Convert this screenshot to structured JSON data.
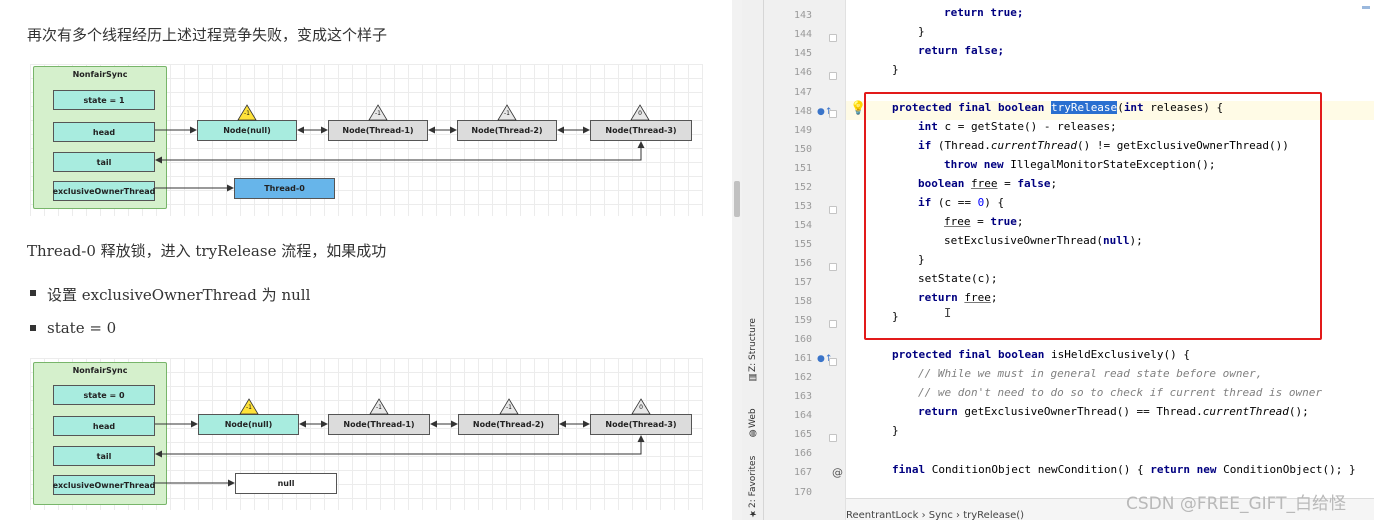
{
  "article": {
    "para1": "再次有多个线程经历上述过程竞争失败，变成这个样子",
    "para2": "Thread-0 释放锁，进入 tryRelease 流程，如果成功",
    "bullets": [
      "设置 exclusiveOwnerThread 为 null",
      "state = 0"
    ]
  },
  "diagram1": {
    "sync_title": "NonfairSync",
    "state": "state = 1",
    "head": "head",
    "tail": "tail",
    "owner": "exclusiveOwnerThread",
    "owner_value": "Thread-0",
    "nodes": [
      "Node(null)",
      "Node(Thread-1)",
      "Node(Thread-2)",
      "Node(Thread-3)"
    ],
    "wait_status": [
      "-1",
      "-1",
      "-1",
      "0"
    ]
  },
  "diagram2": {
    "sync_title": "NonfairSync",
    "state": "state = 0",
    "head": "head",
    "tail": "tail",
    "owner": "exclusiveOwnerThread",
    "owner_value": "null",
    "nodes": [
      "Node(null)",
      "Node(Thread-1)",
      "Node(Thread-2)",
      "Node(Thread-3)"
    ],
    "wait_status": [
      "-1",
      "-1",
      "-1",
      "0"
    ]
  },
  "ide": {
    "line_numbers": [
      "143",
      "144",
      "145",
      "146",
      "147",
      "148",
      "149",
      "150",
      "151",
      "152",
      "153",
      "154",
      "155",
      "156",
      "157",
      "158",
      "159",
      "160",
      "161",
      "162",
      "163",
      "164",
      "165",
      "166",
      "167",
      "170"
    ],
    "tool_windows": [
      "Z: Structure",
      "Web",
      "2: Favorites"
    ],
    "breadcrumb": [
      "ReentrantLock",
      "Sync",
      "tryRelease()"
    ],
    "breadcrumb_sep": "›",
    "colors": {
      "selection": "#2a6fd0",
      "red_frame": "#e21a1a",
      "keyword": "#000080",
      "comment": "#808080",
      "number": "#0000ff"
    }
  },
  "code": {
    "l143a": "return",
    "l143b": " true;",
    "l144": "}",
    "l145a": "return",
    "l145b": " false;",
    "l146": "}",
    "l148_kw": "protected final boolean",
    "l148_sel": "tryRelease",
    "l148_p": "(",
    "l148_int": "int",
    "l148_rest": " releases) {",
    "l149_kw": "int",
    "l149_rest": " c = getState() - releases;",
    "l150_if": "if",
    "l150_a": " (Thread.",
    "l150_it": "currentThread",
    "l150_b": "() != getExclusiveOwnerThread())",
    "l151_kw": "throw new",
    "l151_rest": " IllegalMonitorStateException();",
    "l152_kw": "boolean",
    "l152_sp": " ",
    "l152_var": "free",
    "l152_eq": " = ",
    "l152_val": "false",
    "l152_end": ";",
    "l153_if": "if",
    "l153_a": " (c == ",
    "l153_num": "0",
    "l153_b": ") {",
    "l154_var": "free",
    "l154_eq": " = ",
    "l154_val": "true",
    "l154_end": ";",
    "l155_a": "setExclusiveOwnerThread(",
    "l155_null": "null",
    "l155_b": ");",
    "l156": "}",
    "l157": "setState(c);",
    "l158_kw": "return",
    "l158_sp": " ",
    "l158_var": "free",
    "l158_end": ";",
    "l159": "}",
    "l161_kw": "protected final boolean",
    "l161_rest": " isHeldExclusively() {",
    "l162": "// While we must in general read state before owner,",
    "l163": "// we don't need to do so to check if current thread is owner",
    "l164_kw": "return",
    "l164_a": " getExclusiveOwnerThread() == Thread.",
    "l164_it": "currentThread",
    "l164_b": "();",
    "l165": "}",
    "l167_kw": "final",
    "l167_a": " ConditionObject newCondition() { ",
    "l167_ret": "return new",
    "l167_b": " ConditionObject(); }"
  },
  "watermark": "CSDN @FREE_GIFT_白给怪"
}
